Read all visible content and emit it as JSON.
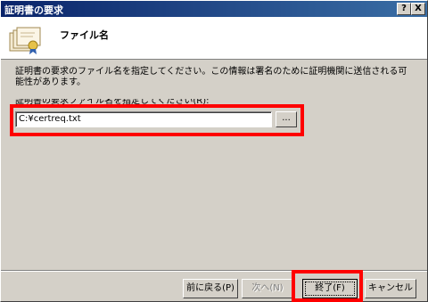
{
  "window": {
    "title": "証明書の要求",
    "help_label": "?",
    "close_label": "X"
  },
  "header": {
    "title": "ファイル名",
    "icon": "certificate-stack-icon"
  },
  "description": "証明書の要求のファイル名を指定してください。この情報は署名のために証明機関に送信される可能性があります。",
  "field": {
    "label": "証明書の要求ファイル名を指定してください(R):",
    "value": "C:¥certreq.txt",
    "browse_label": "..."
  },
  "buttons": {
    "back": "前に戻る(P)",
    "next": "次へ(N)",
    "finish": "終了(F)",
    "cancel": "キャンセル"
  },
  "colors": {
    "highlight": "#ff0000",
    "titlebar": "#0a246a"
  }
}
